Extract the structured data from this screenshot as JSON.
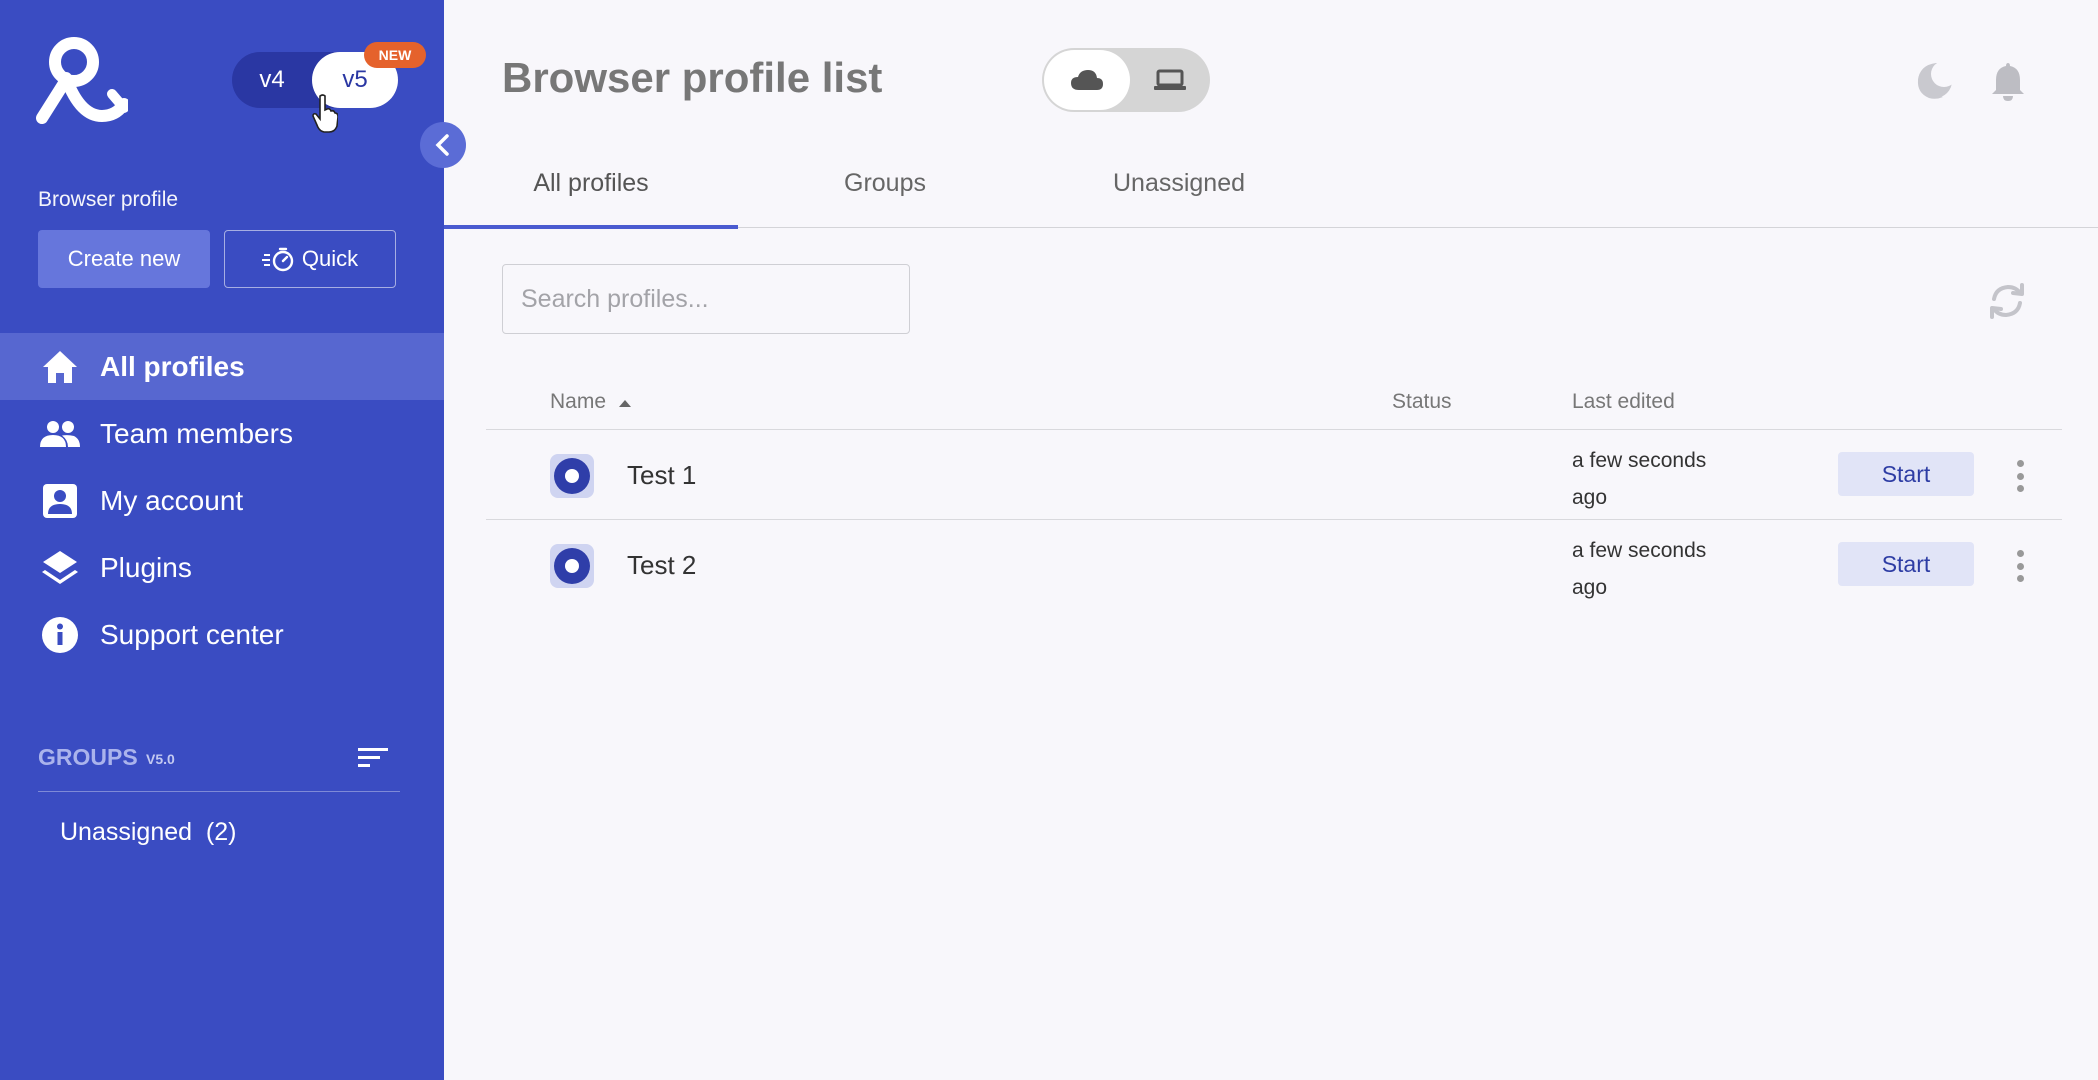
{
  "sidebar": {
    "version_toggle": {
      "v4_label": "v4",
      "v5_label": "v5",
      "badge": "NEW",
      "selected": "v5"
    },
    "section_label": "Browser profile",
    "create_button": "Create new",
    "quick_button": "Quick",
    "nav": [
      {
        "label": "All profiles",
        "icon": "home-icon",
        "active": true
      },
      {
        "label": "Team members",
        "icon": "people-icon",
        "active": false
      },
      {
        "label": "My account",
        "icon": "account-icon",
        "active": false
      },
      {
        "label": "Plugins",
        "icon": "layers-icon",
        "active": false
      },
      {
        "label": "Support center",
        "icon": "info-icon",
        "active": false
      }
    ],
    "groups": {
      "title": "GROUPS",
      "version": "V5.0",
      "items": [
        {
          "label": "Unassigned  (2)"
        }
      ]
    }
  },
  "header": {
    "title": "Browser profile list",
    "mode": {
      "selected": "cloud",
      "options": [
        "cloud-icon",
        "laptop-icon"
      ]
    }
  },
  "tabs": [
    {
      "label": "All profiles",
      "active": true
    },
    {
      "label": "Groups",
      "active": false
    },
    {
      "label": "Unassigned",
      "active": false
    }
  ],
  "search": {
    "placeholder": "Search profiles...",
    "value": ""
  },
  "table": {
    "columns": {
      "name": "Name",
      "status": "Status",
      "last_edited": "Last edited"
    },
    "sort": {
      "column": "Name",
      "direction": "ascending"
    },
    "rows": [
      {
        "name": "Test 1",
        "status": "",
        "last_edited": "a few seconds ago",
        "action": "Start"
      },
      {
        "name": "Test 2",
        "status": "",
        "last_edited": "a few seconds ago",
        "action": "Start"
      }
    ]
  },
  "colors": {
    "sidebar_bg": "#3a4cc2",
    "sidebar_active": "#5767d0",
    "accent": "#4a5bd0",
    "badge": "#e5622c",
    "start_button_bg": "#e1e4f7",
    "start_button_text": "#2d3ca4"
  }
}
